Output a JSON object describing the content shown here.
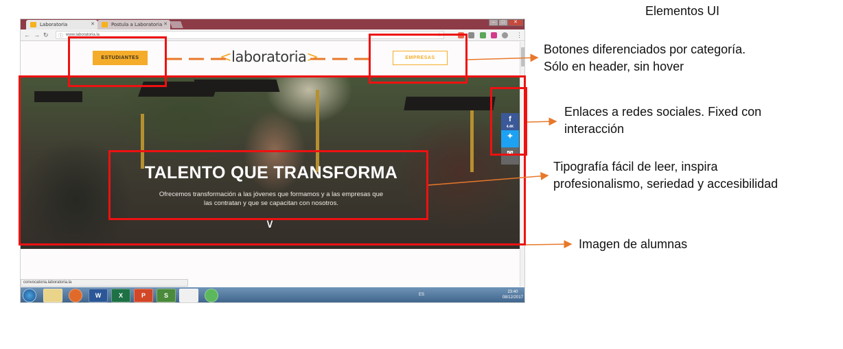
{
  "title": "Elementos UI",
  "browser": {
    "tabs": [
      "Laboratoria",
      "Postula a Laboratoria"
    ],
    "url": "www.laboratoria.la",
    "status_url": "convocatoria.laboratoria.la"
  },
  "site": {
    "logo_text": "laboratoria",
    "btn_students": "ESTUDIANTES",
    "btn_companies": "EMPRESAS",
    "hero_title": "TALENTO QUE TRANSFORMA",
    "hero_subtitle_1": "Ofrecemos transformación a las jóvenes que formamos y a las empresas que",
    "hero_subtitle_2": "las contratan y que se capacitan con nosotros.",
    "share_count": "4.4K"
  },
  "taskbar": {
    "lang": "ES",
    "time": "23:40",
    "date": "08/12/2017",
    "apps": [
      "W",
      "X",
      "P",
      "S"
    ]
  },
  "annotations": {
    "header_buttons_1": "Botones diferenciados por categoría.",
    "header_buttons_2": "Sólo en header, sin hover",
    "social_1": "Enlaces a redes sociales. Fixed con",
    "social_2": "interacción",
    "typography_1": "Tipografía fácil de leer, inspira",
    "typography_2": "profesionalismo, seriedad y accesibilidad",
    "image": "Imagen de alumnas"
  },
  "colors": {
    "accent": "#f4ac2a",
    "annotation_box": "#ee1111",
    "arrow": "#e8782a",
    "facebook": "#3b5998",
    "twitter": "#1da1f2"
  }
}
